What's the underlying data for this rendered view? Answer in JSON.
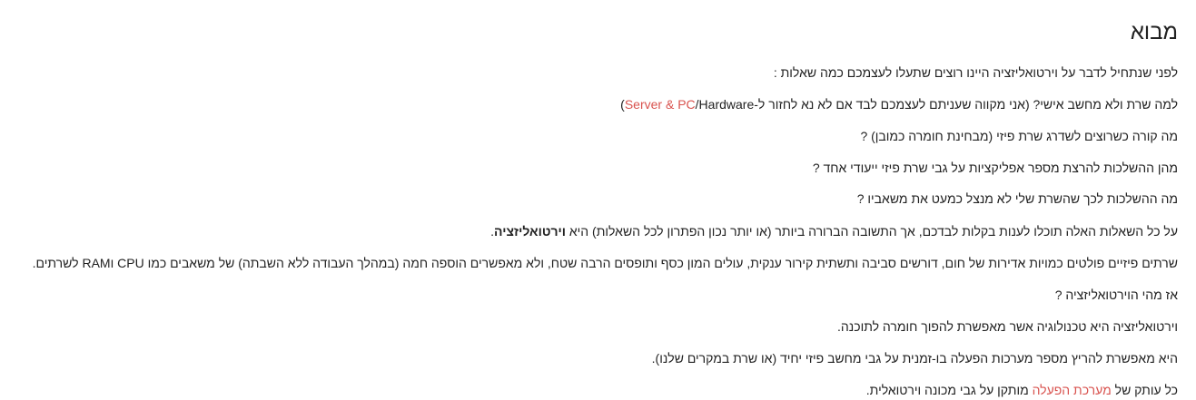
{
  "article": {
    "heading": "מבוא",
    "paragraphs": {
      "p1": "לפני שנתחיל לדבר על וירטואליזציה היינו רוצים שתעלו לעצמכם כמה שאלות :",
      "p2": {
        "before": "למה שרת ולא מחשב אישי? (אני מקווה שעניתם לעצמכם לבד אם לא נא לחזור ל-",
        "link": "Server & PC",
        "after": "/Hardware)"
      },
      "p3": "מה קורה כשרוצים לשדרג שרת פיזי (מבחינת חומרה כמובן) ?",
      "p4": "מהן ההשלכות להרצת מספר אפליקציות על גבי שרת פיזי ייעודי אחד ?",
      "p5": "מה ההשלכות לכך שהשרת שלי לא מנצל כמעט את משאביו ?",
      "p6": {
        "before": "על כל השאלות האלה תוכלו לענות בקלות לבדכם, אך התשובה הברורה ביותר (או יותר נכון הפתרון לכל השאלות) היא ",
        "bold": "וירטואליזציה",
        "after": "."
      },
      "p7": "שרתים פיזיים פולטים כמויות אדירות של חום, דורשים סביבה ותשתית קירור ענקית, עולים המון כסף ותופסים הרבה שטח, ולא מאפשרים הוספה חמה (במהלך העבודה ללא השבתה) של משאבים כמו CPU וRAM לשרתים.",
      "p8": "אז מהי הוירטואליזציה ?",
      "p9": "וירטואליזציה היא טכנולוגיה אשר מאפשרת להפוך חומרה לתוכנה.",
      "p10": "היא מאפשרת להריץ מספר מערכות הפעלה בו-זמנית על גבי מחשב פיזי יחיד (או שרת במקרים שלנו).",
      "p11": {
        "before": "כל עותק של ",
        "link": "מערכת הפעלה",
        "after": " מותקן על גבי מכונה וירטואלית."
      }
    }
  },
  "colors": {
    "text": "#222222",
    "link": "#d9534f",
    "background": "#ffffff"
  }
}
